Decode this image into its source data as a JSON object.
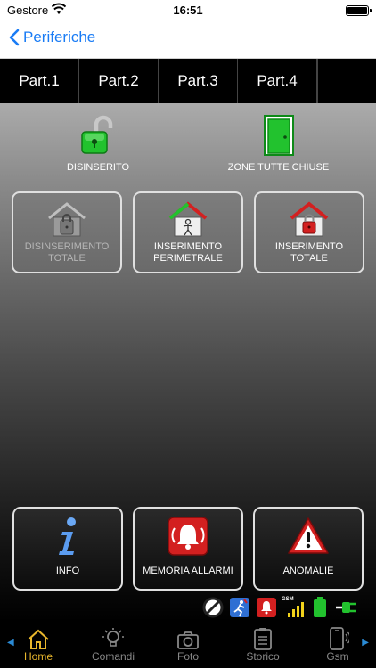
{
  "status_bar": {
    "carrier": "Gestore",
    "time": "16:51"
  },
  "nav": {
    "back_label": "Periferiche"
  },
  "tabs": [
    {
      "label": "Part.1",
      "active": true
    },
    {
      "label": "Part.2",
      "active": false
    },
    {
      "label": "Part.3",
      "active": false
    },
    {
      "label": "Part.4",
      "active": false
    }
  ],
  "status": {
    "arm_state": "DISINSERITO",
    "zones_state": "ZONE TUTTE CHIUSE"
  },
  "commands": {
    "disarm": "DISINSERIMENTO\nTOTALE",
    "perimeter": "INSERIMENTO\nPERIMETRALE",
    "total": "INSERIMENTO\nTOTALE"
  },
  "actions": {
    "info": "INFO",
    "alarm_memory": "MEMORIA ALLARMI",
    "anomalies": "ANOMALIE"
  },
  "gsm_badge": "GSM",
  "tabbar": [
    {
      "label": "Home",
      "icon": "home-icon",
      "active": true
    },
    {
      "label": "Comandi",
      "icon": "lightbulb-icon",
      "active": false
    },
    {
      "label": "Foto",
      "icon": "camera-icon",
      "active": false
    },
    {
      "label": "Storico",
      "icon": "clipboard-icon",
      "active": false
    },
    {
      "label": "Gsm",
      "icon": "phone-icon",
      "active": false
    }
  ],
  "colors": {
    "accent": "#1a7cf5",
    "active_tab": "#e8b62c",
    "ok_green": "#22c22e",
    "alarm_red": "#d32020"
  }
}
